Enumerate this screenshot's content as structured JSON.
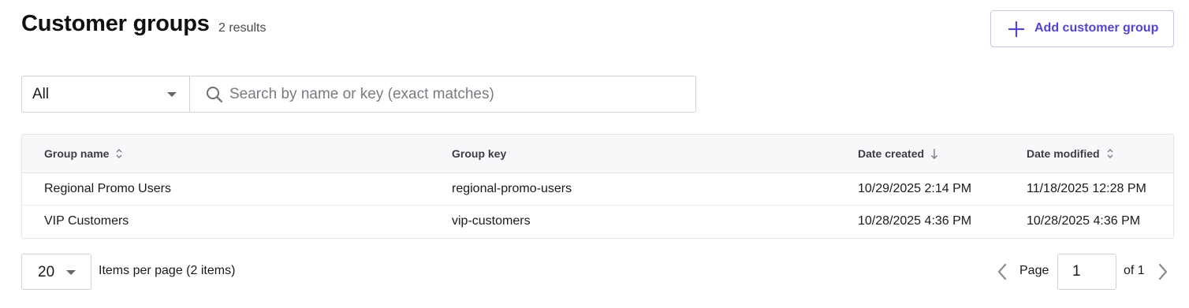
{
  "header": {
    "title": "Customer groups",
    "result_count": "2 results",
    "add_button_label": "Add customer group"
  },
  "filters": {
    "select_value": "All",
    "search_placeholder": "Search by name or key (exact matches)"
  },
  "table": {
    "columns": [
      {
        "label": "Group name",
        "sort": "sortable"
      },
      {
        "label": "Group key",
        "sort": "none"
      },
      {
        "label": "Date created",
        "sort": "descending"
      },
      {
        "label": "Date modified",
        "sort": "sortable"
      }
    ],
    "rows": [
      [
        "Regional Promo Users",
        "regional-promo-users",
        "10/29/2025 2:14 PM",
        "11/18/2025 12:28 PM"
      ],
      [
        "VIP Customers",
        "vip-customers",
        "10/28/2025 4:36 PM",
        "10/28/2025 4:36 PM"
      ]
    ]
  },
  "pagination": {
    "per_page_value": "20",
    "per_page_label": "Items per page (2 items)",
    "page_label": "Page",
    "current_page": "1",
    "of_label": "of 1"
  },
  "icons": {
    "add": "plus-icon",
    "search": "search-icon",
    "sortable": "sort-icon",
    "sorted_desc": "arrow-down-icon",
    "prev": "chevron-left-icon",
    "next": "chevron-right-icon",
    "dropdown": "caret-down-icon"
  },
  "colors": {
    "accent": "#5146c9",
    "border": "#d2d2d6",
    "header_bg": "#f8f8fa"
  }
}
